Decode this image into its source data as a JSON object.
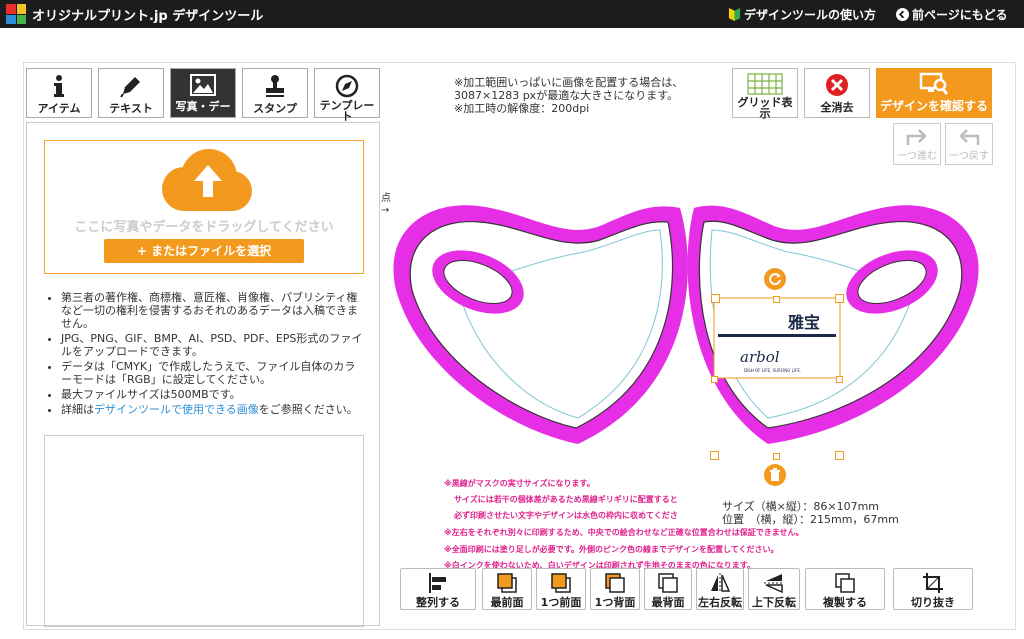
{
  "header": {
    "logo_text": "オリジナルプリント.jp デザインツール",
    "howto_label": "デザインツールの使い方",
    "back_label": "前ページにもどる"
  },
  "tabs": [
    {
      "label": "アイテム",
      "icon": "info-icon"
    },
    {
      "label": "テキスト",
      "icon": "pen-icon"
    },
    {
      "label": "写真・デー",
      "icon": "image-icon",
      "active": true
    },
    {
      "label": "スタンプ",
      "icon": "stamp-icon"
    },
    {
      "label": "テンプレー ト",
      "icon": "compass-icon"
    }
  ],
  "upload": {
    "drop_text": "ここに写真やデータをドラッグしてください",
    "select_label": "+ またはファイルを選択"
  },
  "notes": [
    "第三者の著作権、商標権、意匠権、肖像権、パブリシティ権など一切の権利を侵害するおそれのあるデータは入稿できません。",
    "JPG、PNG、GIF、BMP、AI、PSD、PDF、EPS形式のファイルをアップロードできます。",
    "データは「CMYK」で作成したうえで、ファイル自体のカラーモードは「RGB」に設定してください。",
    "最大ファイルサイズは500MBです。"
  ],
  "notes_detail": {
    "prefix": "詳細は",
    "link": "デザインツールで使用できる画像",
    "suffix": "をご参照ください。"
  },
  "info": {
    "line1": "※加工範囲いっぱいに画像を配置する場合は、",
    "line2": "3087×1283 pxが最適な大きさになります。",
    "line3": "※加工時の解像度：200dpi"
  },
  "toolbar": {
    "grid_label": "グリッド表示",
    "clear_label": "全消去",
    "confirm_label": "デザインを確認する",
    "redo_label": "一つ進む",
    "undo_label": "一つ戻す"
  },
  "canvas": {
    "side_label": "点",
    "side_arrow": "→",
    "logo_kanji": "雅宝",
    "logo_script": "arbol",
    "logo_tagline": "DISH OF LIFE, SURFING LIFE."
  },
  "warnings": [
    "※黒線がマスクの実寸サイズになります。",
    "サイズには若干の個体差があるため黒線ギリギリに配置すると",
    "必ず印刷させたい文字やデザインは水色の枠内に収めてくださ",
    "※左右をそれぞれ別々に印刷するため、中央での絵合わせなど正確な位置合わせは保証できません。",
    "※全面印刷には塗り足しが必要です。外側のピンク色の線までデザインを配置してください。",
    "※白インクを使わないため、白いデザインは印刷されず生地そのままの色になります。"
  ],
  "selection": {
    "size_label": "サイズ（横×縦）：86×107mm",
    "pos_label": "位置　（横，縦）：215mm，67mm"
  },
  "bottom_buttons": [
    "整列する",
    "最前面",
    "1つ前面",
    "1つ背面",
    "最背面",
    "左右反転",
    "上下反転",
    "複製する",
    "切り抜き"
  ],
  "colors": {
    "accent": "#f39a1e",
    "magenta": "#e62ee6",
    "link": "#2c8fd6",
    "warn": "#e0208c"
  }
}
